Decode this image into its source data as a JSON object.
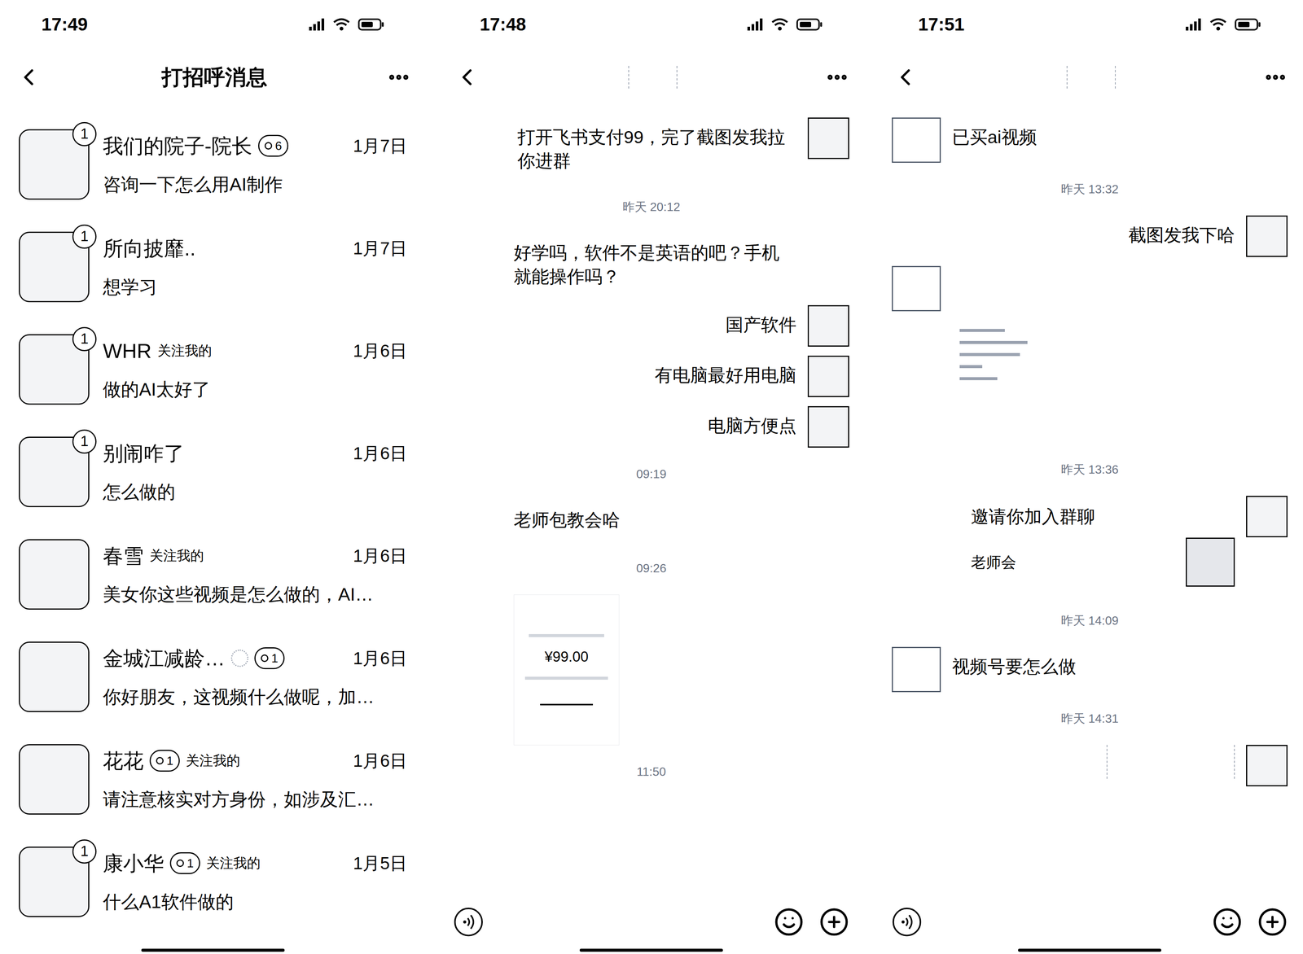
{
  "list_panel": {
    "status_time": "17:49",
    "title": "打招呼消息",
    "items": [
      {
        "name": "我们的院子-院长",
        "level": "6",
        "tag": "",
        "dotted": false,
        "unread": "1",
        "date": "1月7日",
        "message": "咨询一下怎么用AI制作"
      },
      {
        "name": "所向披靡..",
        "level": "",
        "tag": "",
        "dotted": false,
        "unread": "1",
        "date": "1月7日",
        "message": "想学习"
      },
      {
        "name": "WHR",
        "level": "",
        "tag": "关注我的",
        "dotted": false,
        "unread": "1",
        "date": "1月6日",
        "message": "做的AI太好了"
      },
      {
        "name": "别闹咋了",
        "level": "",
        "tag": "",
        "dotted": false,
        "unread": "1",
        "date": "1月6日",
        "message": "怎么做的"
      },
      {
        "name": "春雪",
        "level": "",
        "tag": "关注我的",
        "dotted": false,
        "unread": "",
        "date": "1月6日",
        "message": "美女你这些视频是怎么做的，AI…"
      },
      {
        "name": "金城江减龄…",
        "level": "1",
        "tag": "",
        "dotted": true,
        "unread": "",
        "date": "1月6日",
        "message": "你好朋友，这视频什么做呢，加…"
      },
      {
        "name": "花花",
        "level": "1",
        "tag": "关注我的",
        "dotted": false,
        "unread": "",
        "date": "1月6日",
        "message": "请注意核实对方身份，如涉及汇…"
      },
      {
        "name": "康小华",
        "level": "1",
        "tag": "关注我的",
        "dotted": false,
        "unread": "1",
        "date": "1月5日",
        "message": "什么A1软件做的"
      }
    ]
  },
  "chats": [
    {
      "status_time": "17:48",
      "messages": [
        {
          "kind": "text",
          "side": "right",
          "avatar": true,
          "text": "打开飞书支付99，完了截图发我拉你进群"
        },
        {
          "kind": "time",
          "text": "昨天 20:12"
        },
        {
          "kind": "text",
          "side": "left",
          "avatar": false,
          "text": "好学吗，软件不是英语的吧？手机就能操作吗？"
        },
        {
          "kind": "text",
          "side": "right",
          "avatar": true,
          "text": "国产软件"
        },
        {
          "kind": "text",
          "side": "right",
          "avatar": true,
          "text": "有电脑最好用电脑"
        },
        {
          "kind": "text",
          "side": "right",
          "avatar": true,
          "text": "电脑方便点"
        },
        {
          "kind": "time",
          "text": "09:19"
        },
        {
          "kind": "text",
          "side": "left",
          "avatar": false,
          "text": "老师包教会哈"
        },
        {
          "kind": "time",
          "text": "09:26"
        },
        {
          "kind": "payment",
          "side": "left",
          "avatar": false,
          "text": "¥99.00"
        },
        {
          "kind": "time",
          "text": "11:50"
        }
      ]
    },
    {
      "status_time": "17:51",
      "messages": [
        {
          "kind": "text",
          "side": "left",
          "avatar": true,
          "text": "已买ai视频"
        },
        {
          "kind": "time",
          "text": "昨天 13:32"
        },
        {
          "kind": "text",
          "side": "right",
          "avatar": true,
          "text": "截图发我下哈"
        },
        {
          "kind": "image",
          "side": "left",
          "avatar": true,
          "text": ""
        },
        {
          "kind": "time",
          "text": "昨天 13:36"
        },
        {
          "kind": "invite",
          "side": "right",
          "avatar": true,
          "text": "邀请你加入群聊",
          "subtitle": "老师会"
        },
        {
          "kind": "time",
          "text": "昨天 14:09"
        },
        {
          "kind": "text",
          "side": "left",
          "avatar": true,
          "text": "视频号要怎么做"
        },
        {
          "kind": "time",
          "text": "昨天 14:31"
        },
        {
          "kind": "blank",
          "side": "right",
          "avatar": true,
          "text": ""
        }
      ]
    }
  ]
}
